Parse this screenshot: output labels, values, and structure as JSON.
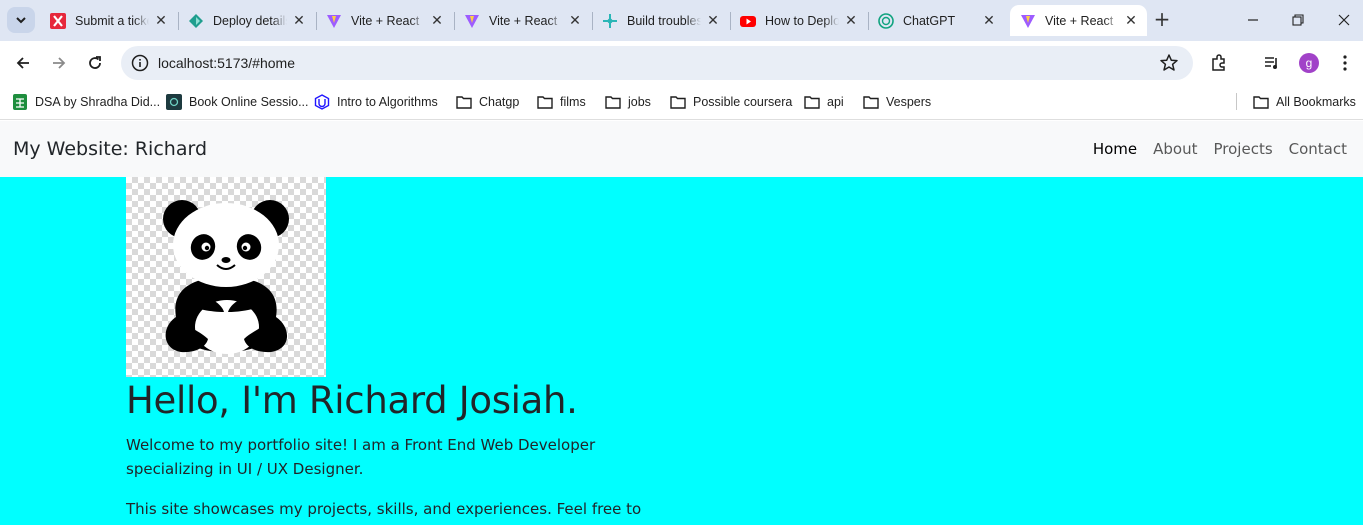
{
  "browser": {
    "tabs": [
      {
        "title": "Submit a ticket",
        "icon": "zendesk-x-icon",
        "color": "#e6283c"
      },
      {
        "title": "Deploy details",
        "icon": "netlify-icon",
        "color": "#1f9e8e"
      },
      {
        "title": "Vite + React",
        "icon": "vite-icon",
        "color": "#9d5cff"
      },
      {
        "title": "Vite + React",
        "icon": "vite-icon",
        "color": "#9d5cff"
      },
      {
        "title": "Build troubleshooting",
        "icon": "netlify-build-icon",
        "color": "#2ab6b6"
      },
      {
        "title": "How to Deploy",
        "icon": "youtube-icon",
        "color": "#ff0000"
      },
      {
        "title": "ChatGPT",
        "icon": "chatgpt-icon",
        "color": "#10a37f"
      },
      {
        "title": "Vite + React",
        "icon": "vite-icon",
        "color": "#9d5cff",
        "active": true
      }
    ],
    "url": "localhost:5173/#home",
    "profile_initial": "g",
    "bookmarks": [
      {
        "label": "DSA by Shradha Did...",
        "icon": "sheets-icon"
      },
      {
        "label": "Book Online Sessio...",
        "icon": "site-icon"
      },
      {
        "label": "Intro to Algorithms",
        "icon": "udacity-icon"
      },
      {
        "label": "Chatgp",
        "icon": "folder-icon"
      },
      {
        "label": "films",
        "icon": "folder-icon"
      },
      {
        "label": "jobs",
        "icon": "folder-icon"
      },
      {
        "label": "Possible coursera",
        "icon": "folder-icon"
      },
      {
        "label": "api",
        "icon": "folder-icon"
      },
      {
        "label": "Vespers",
        "icon": "folder-icon"
      }
    ],
    "all_bookmarks": "All Bookmarks"
  },
  "page": {
    "brand": "My Website: Richard",
    "nav": [
      "Home",
      "About",
      "Projects",
      "Contact"
    ],
    "heading": "Hello, I'm Richard Josiah.",
    "intro": "Welcome to my portfolio site! I am a Front End Web Developer specializing in UI / UX Designer.",
    "intro2": "This site showcases my projects, skills, and experiences. Feel free to explore!",
    "hero_bg": "#00ffff"
  }
}
